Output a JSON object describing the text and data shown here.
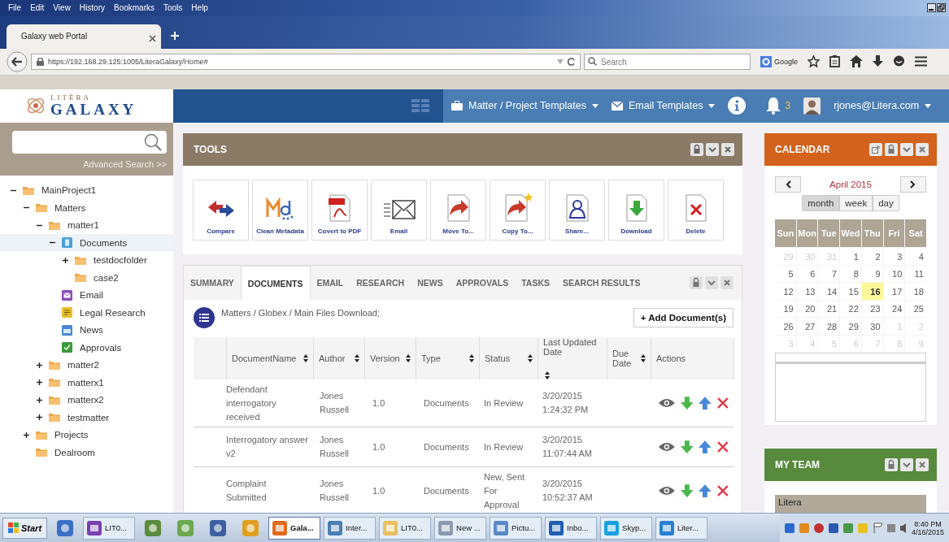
{
  "browser": {
    "menu": [
      "File",
      "Edit",
      "View",
      "History",
      "Bookmarks",
      "Tools",
      "Help"
    ],
    "tab": {
      "title": "Galaxy web Portal"
    },
    "url": "https://192.168.29.125:1005/LiteraGalaxy/Home#",
    "search": {
      "placeholder": "Search"
    },
    "search_engine": "Google"
  },
  "app": {
    "logo": {
      "top": "LITÉRA",
      "bottom": "GALAXY"
    },
    "nav": [
      {
        "label": "Matter / Project Templates",
        "kind": "briefcase"
      },
      {
        "label": "Email Templates",
        "kind": "envelope"
      }
    ],
    "notifications": "3",
    "user": "rjones@Litera.com"
  },
  "sidebar": {
    "advanced_search": "Advanced Search >>",
    "tree": [
      {
        "label": "MainProject1",
        "kind": "folder",
        "expanded": true,
        "selected": false,
        "children": [
          {
            "label": "Matters",
            "kind": "folder",
            "expanded": true,
            "selected": false,
            "children": [
              {
                "label": "matter1",
                "kind": "folder",
                "expanded": true,
                "selected": false,
                "children": [
                  {
                    "label": "Documents",
                    "kind": "documents",
                    "expanded": true,
                    "selected": true,
                    "children": [
                      {
                        "label": "testdocfolder",
                        "kind": "folder",
                        "expanded": false,
                        "selected": false
                      },
                      {
                        "label": "case2",
                        "kind": "folder",
                        "selected": false
                      }
                    ]
                  },
                  {
                    "label": "Email",
                    "kind": "email",
                    "selected": false
                  },
                  {
                    "label": "Legal Research",
                    "kind": "research",
                    "selected": false
                  },
                  {
                    "label": "News",
                    "kind": "news",
                    "selected": false
                  },
                  {
                    "label": "Approvals",
                    "kind": "approvals",
                    "selected": false
                  }
                ]
              },
              {
                "label": "matter2",
                "kind": "folder",
                "expanded": false,
                "selected": false
              },
              {
                "label": "matterx1",
                "kind": "folder",
                "expanded": false,
                "selected": false
              },
              {
                "label": "matterx2",
                "kind": "folder",
                "expanded": false,
                "selected": false
              },
              {
                "label": "testmatter",
                "kind": "folder",
                "expanded": false,
                "selected": false
              }
            ]
          },
          {
            "label": "Projects",
            "kind": "folder",
            "expanded": false,
            "selected": false
          },
          {
            "label": "Dealroom",
            "kind": "folder",
            "selected": false
          }
        ]
      }
    ]
  },
  "tools": {
    "title": "TOOLS",
    "items": [
      {
        "label": "Compare",
        "kind": "compare"
      },
      {
        "label": "Clean Metadata",
        "kind": "metadata"
      },
      {
        "label": "Covert to PDF",
        "kind": "pdf"
      },
      {
        "label": "Email",
        "kind": "email"
      },
      {
        "label": "Move To...",
        "kind": "move"
      },
      {
        "label": "Copy To...",
        "kind": "copy"
      },
      {
        "label": "Share...",
        "kind": "share"
      },
      {
        "label": "Download",
        "kind": "download"
      },
      {
        "label": "Delete",
        "kind": "delete"
      }
    ]
  },
  "tabs": [
    {
      "label": "SUMMARY",
      "selected": false
    },
    {
      "label": "DOCUMENTS",
      "selected": true
    },
    {
      "label": "EMAIL",
      "selected": false
    },
    {
      "label": "RESEARCH",
      "selected": false
    },
    {
      "label": "NEWS",
      "selected": false
    },
    {
      "label": "APPROVALS",
      "selected": false
    },
    {
      "label": "TASKS",
      "selected": false
    },
    {
      "label": "SEARCH RESULTS",
      "selected": false
    }
  ],
  "documents": {
    "breadcrumb": "Matters / Globex / Main Files Download;",
    "add_button": "+ Add Document(s)",
    "table": {
      "columns": [
        {
          "label": "DocumentName",
          "sortable": true
        },
        {
          "label": "Author",
          "sortable": true
        },
        {
          "label": "Version",
          "sortable": true
        },
        {
          "label": "Type",
          "sortable": true
        },
        {
          "label": "Status",
          "sortable": true
        },
        {
          "label": "Last Updated Date",
          "sortable": true
        },
        {
          "label": "Due Date",
          "sortable": true
        },
        {
          "label": "Actions",
          "sortable": false
        }
      ],
      "rows": [
        {
          "name": "Defendant interrogatory received",
          "author": "Jones Russell",
          "version": "1.0",
          "type": "Documents",
          "status": "In Review",
          "updated": [
            "3/20/2015",
            "1:24:32 PM"
          ]
        },
        {
          "name": "Interrogatory answer v2",
          "author": "Jones Russell",
          "version": "1.0",
          "type": "Documents",
          "status": "In Review",
          "updated": [
            "3/20/2015",
            "11:07:44 AM"
          ]
        },
        {
          "name": "Complaint Submitted",
          "author": "Jones Russell",
          "version": "1.0",
          "type": "Documents",
          "status": "New, Sent For Approval",
          "updated": [
            "3/20/2015",
            "10:52:37 AM"
          ]
        }
      ]
    }
  },
  "calendar": {
    "title": "CALENDAR",
    "month": "April 2015",
    "views": [
      {
        "label": "month",
        "selected": true
      },
      {
        "label": "week",
        "selected": false
      },
      {
        "label": "day",
        "selected": false
      }
    ],
    "weekdays": [
      "Sun",
      "Mon",
      "Tue",
      "Wed",
      "Thu",
      "Fri",
      "Sat"
    ],
    "weeks": [
      [
        {
          "text": "29",
          "outside": true,
          "today": false
        },
        {
          "text": "30",
          "outside": true,
          "today": false
        },
        {
          "text": "31",
          "outside": true,
          "today": false
        },
        {
          "text": "1",
          "outside": false,
          "today": false
        },
        {
          "text": "2",
          "outside": false,
          "today": false
        },
        {
          "text": "3",
          "outside": false,
          "today": false
        },
        {
          "text": "4",
          "outside": false,
          "today": false
        }
      ],
      [
        {
          "text": "5",
          "outside": false,
          "today": false
        },
        {
          "text": "6",
          "outside": false,
          "today": false
        },
        {
          "text": "7",
          "outside": false,
          "today": false
        },
        {
          "text": "8",
          "outside": false,
          "today": false
        },
        {
          "text": "9",
          "outside": false,
          "today": false
        },
        {
          "text": "10",
          "outside": false,
          "today": false
        },
        {
          "text": "11",
          "outside": false,
          "today": false
        }
      ],
      [
        {
          "text": "12",
          "outside": false,
          "today": false
        },
        {
          "text": "13",
          "outside": false,
          "today": false
        },
        {
          "text": "14",
          "outside": false,
          "today": false
        },
        {
          "text": "15",
          "outside": false,
          "today": false
        },
        {
          "text": "16",
          "outside": false,
          "today": true
        },
        {
          "text": "17",
          "outside": false,
          "today": false
        },
        {
          "text": "18",
          "outside": false,
          "today": false
        }
      ],
      [
        {
          "text": "19",
          "outside": false,
          "today": false
        },
        {
          "text": "20",
          "outside": false,
          "today": false
        },
        {
          "text": "21",
          "outside": false,
          "today": false
        },
        {
          "text": "22",
          "outside": false,
          "today": false
        },
        {
          "text": "23",
          "outside": false,
          "today": false
        },
        {
          "text": "24",
          "outside": false,
          "today": false
        },
        {
          "text": "25",
          "outside": false,
          "today": false
        }
      ],
      [
        {
          "text": "26",
          "outside": false,
          "today": false
        },
        {
          "text": "27",
          "outside": false,
          "today": false
        },
        {
          "text": "28",
          "outside": false,
          "today": false
        },
        {
          "text": "29",
          "outside": false,
          "today": false
        },
        {
          "text": "30",
          "outside": false,
          "today": false
        },
        {
          "text": "1",
          "outside": true,
          "today": false
        },
        {
          "text": "2",
          "outside": true,
          "today": false
        }
      ],
      [
        {
          "text": "3",
          "outside": true,
          "today": false
        },
        {
          "text": "4",
          "outside": true,
          "today": false
        },
        {
          "text": "5",
          "outside": true,
          "today": false
        },
        {
          "text": "6",
          "outside": true,
          "today": false
        },
        {
          "text": "7",
          "outside": true,
          "today": false
        },
        {
          "text": "8",
          "outside": true,
          "today": false
        },
        {
          "text": "9",
          "outside": true,
          "today": false
        }
      ]
    ]
  },
  "my_team": {
    "title": "MY TEAM",
    "members": [
      "Litera"
    ]
  },
  "taskbar": {
    "start": "Start",
    "items": [
      {
        "kind": "launcher",
        "color": "#3b6fc4"
      },
      {
        "kind": "window",
        "label": "LIT0...",
        "color": "#7a3fb0",
        "selected": false
      },
      {
        "kind": "launcher",
        "color": "#5a8a3c"
      },
      {
        "kind": "launcher",
        "color": "#6aa84f"
      },
      {
        "kind": "launcher",
        "color": "#3b5fa0"
      },
      {
        "kind": "launcher",
        "color": "#e0a020"
      },
      {
        "kind": "window",
        "label": "Gala...",
        "color": "#e06a1c",
        "selected": true
      },
      {
        "kind": "window",
        "label": "Inter...",
        "color": "#4a7db3",
        "selected": false
      },
      {
        "kind": "window",
        "label": "LIT0...",
        "color": "#e8c060",
        "selected": false
      },
      {
        "kind": "window",
        "label": "New ...",
        "color": "#8a9ab0",
        "selected": false
      },
      {
        "kind": "window",
        "label": "Pictu...",
        "color": "#5a8ac8",
        "selected": false
      },
      {
        "kind": "window",
        "label": "Inbo...",
        "color": "#1f5fb0",
        "selected": false
      },
      {
        "kind": "window",
        "label": "Skyp...",
        "color": "#1aa0e0",
        "selected": false
      },
      {
        "kind": "window",
        "label": "Liter...",
        "color": "#2a80d0",
        "selected": false
      }
    ],
    "time": "8:40 PM",
    "date": "4/16/2015"
  }
}
